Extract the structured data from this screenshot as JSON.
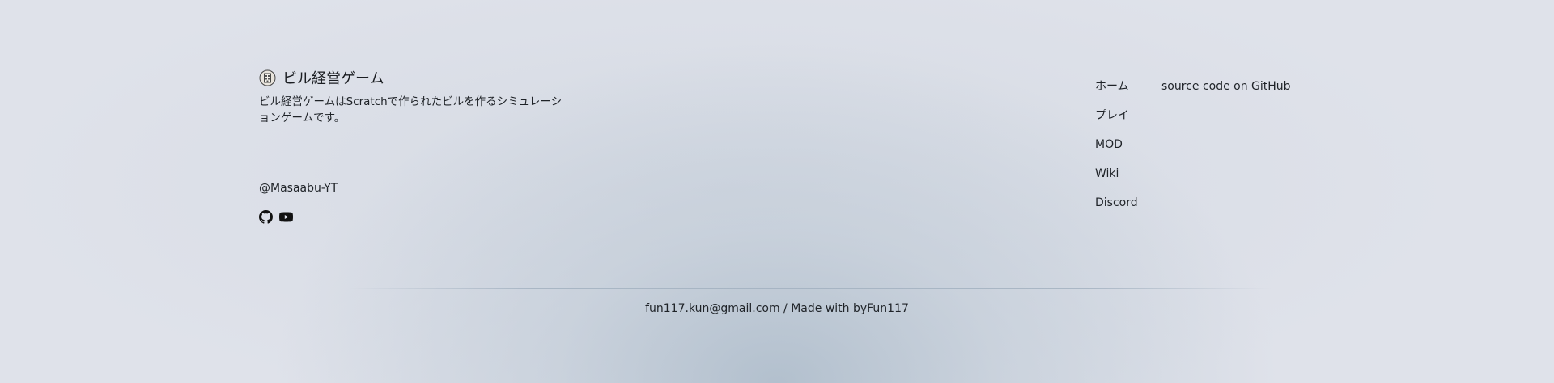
{
  "brand": {
    "title": "ビル経営ゲーム",
    "logo_icon": "building-logo-icon",
    "description": "ビル経営ゲームはScratchで作られたビルを作るシミュレーションゲームです。"
  },
  "author": {
    "handle": "@Masaabu-YT",
    "socials": [
      {
        "icon": "github-icon"
      },
      {
        "icon": "youtube-icon"
      }
    ]
  },
  "nav": {
    "links": [
      {
        "label": "ホーム"
      },
      {
        "label": "プレイ"
      },
      {
        "label": "MOD"
      },
      {
        "label": "Wiki"
      },
      {
        "label": "Discord"
      }
    ],
    "source_link": "source code on GitHub"
  },
  "footer": {
    "copyright": "fun117.kun@gmail.com / Made with byFun117"
  },
  "colors": {
    "background": "#dfe2ea",
    "text": "#1f2328",
    "glow": "#b0becc"
  }
}
